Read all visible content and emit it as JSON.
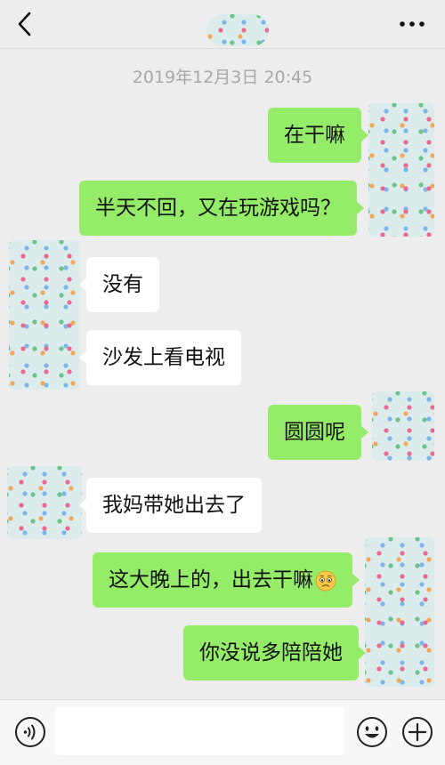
{
  "header": {
    "back_icon": "chevron-left-icon",
    "more_icon": "more-dots-icon",
    "contact_name_obscured": true
  },
  "timestamp": "2019年12月3日 20:45",
  "messages": [
    {
      "side": "out",
      "text": "在干嘛"
    },
    {
      "side": "out",
      "text": "半天不回，又在玩游戏吗？"
    },
    {
      "side": "in",
      "text": "没有"
    },
    {
      "side": "in",
      "text": "沙发上看电视"
    },
    {
      "side": "out",
      "text": "圆圆呢"
    },
    {
      "side": "in",
      "text": "我妈带她出去了"
    },
    {
      "side": "out",
      "text": "这大晚上的，出去干嘛",
      "emoji": "worried-face-emoji"
    },
    {
      "side": "out",
      "text": "你没说多陪陪她"
    }
  ],
  "composer": {
    "voice_icon": "voice-icon",
    "input_value": "",
    "emoji_icon": "smile-icon",
    "more_icon": "plus-icon"
  },
  "colors": {
    "background": "#ededed",
    "outgoing_bubble": "#95ec69",
    "incoming_bubble": "#ffffff",
    "timestamp": "#a8a8a8"
  }
}
